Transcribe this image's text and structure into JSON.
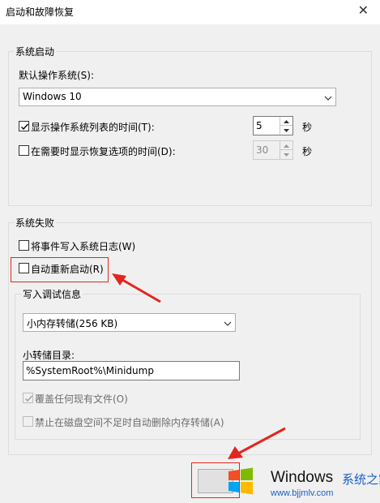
{
  "window": {
    "title": "启动和故障恢复",
    "close_glyph": "✕"
  },
  "system_startup": {
    "group_label": "系统启动",
    "default_os_label": "默认操作系统(S):",
    "default_os_value": "Windows 10",
    "show_os_list": {
      "label": "显示操作系统列表的时间(T):",
      "checked": true,
      "value": "5",
      "unit": "秒"
    },
    "show_recovery": {
      "label": "在需要时显示恢复选项的时间(D):",
      "checked": false,
      "value": "30",
      "unit": "秒"
    }
  },
  "system_failure": {
    "group_label": "系统失败",
    "write_event_log": {
      "label": "将事件写入系统日志(W)",
      "checked": false
    },
    "auto_restart": {
      "label": "自动重新启动(R)",
      "checked": false
    },
    "debug_info": {
      "group_label": "写入调试信息",
      "dump_type": "小内存转储(256 KB)",
      "dump_dir_label": "小转储目录:",
      "dump_dir_value": "%SystemRoot%\\Minidump",
      "overwrite": {
        "label": "覆盖任何现有文件(O)",
        "checked": true,
        "disabled": true
      },
      "disable_autodelete": {
        "label": "禁止在磁盘空间不足时自动删除内存转储(A)",
        "checked": false,
        "disabled": true
      }
    }
  },
  "watermark": {
    "brand": "Windows",
    "suffix": "系统之家",
    "url": "www.bjjmlv.com"
  },
  "colors": {
    "annotation_red": "#e2261f",
    "accent_blue": "#1a5fc7"
  }
}
